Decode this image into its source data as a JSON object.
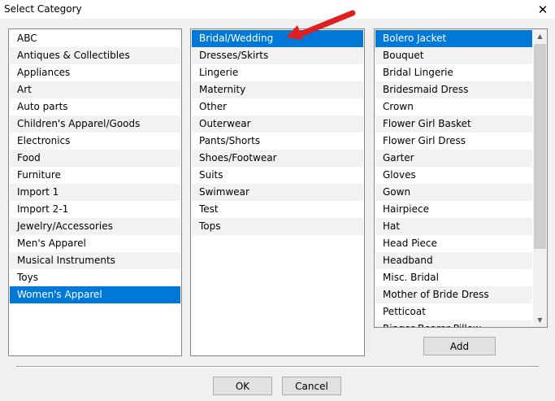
{
  "window": {
    "title": "Select Category",
    "close_glyph": "✕"
  },
  "categories": [
    "ABC",
    "Antiques & Collectibles",
    "Appliances",
    "Art",
    "Auto parts",
    "Children's Apparel/Goods",
    "Electronics",
    "Food",
    "Furniture",
    "Import 1",
    "Import 2-1",
    "Jewelry/Accessories",
    "Men's Apparel",
    "Musical Instruments",
    "Toys",
    "Women's Apparel"
  ],
  "categories_selected": 15,
  "subcategories": [
    "Bridal/Wedding",
    "Dresses/Skirts",
    "Lingerie",
    "Maternity",
    "Other",
    "Outerwear",
    "Pants/Shorts",
    "Shoes/Footwear",
    "Suits",
    "Swimwear",
    "Test",
    "Tops"
  ],
  "subcategories_selected": 0,
  "items": [
    "Bolero Jacket",
    "Bouquet",
    "Bridal Lingerie",
    "Bridesmaid Dress",
    "Crown",
    "Flower Girl Basket",
    "Flower Girl Dress",
    "Garter",
    "Gloves",
    "Gown",
    "Hairpiece",
    "Hat",
    "Head Piece",
    "Headband",
    "Misc. Bridal",
    "Mother of Bride Dress",
    "Petticoat",
    "Ringer Bearer Pillow"
  ],
  "items_selected": 0,
  "buttons": {
    "add": "Add",
    "ok": "OK",
    "cancel": "Cancel"
  },
  "colors": {
    "selection": "#0078d7",
    "alt_row": "#f2f2f2",
    "annotation_arrow": "#e02020"
  },
  "icons": {
    "close": "close-icon",
    "scroll_up": "scroll-up-icon",
    "scroll_down": "scroll-down-icon",
    "annotation": "annotation-arrow-icon"
  }
}
